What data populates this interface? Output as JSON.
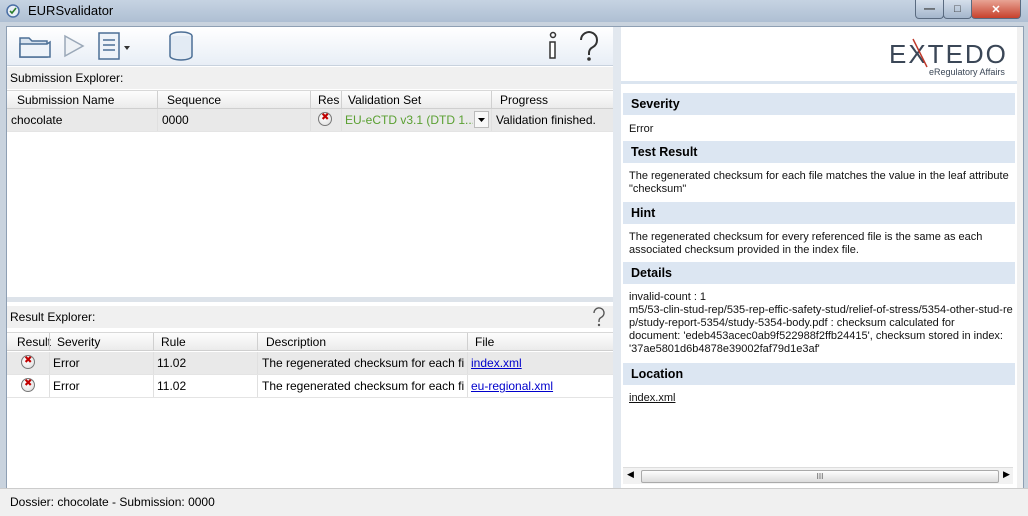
{
  "window": {
    "title": "EURSvalidator"
  },
  "logo": {
    "brand": "EXTEDO",
    "tagline": "eRegulatory Affairs"
  },
  "submission_explorer": {
    "title": "Submission Explorer:",
    "columns": [
      "Submission Name",
      "Sequence",
      "Resi",
      "Validation Set",
      "Progress"
    ],
    "rows": [
      {
        "name": "chocolate",
        "sequence": "0000",
        "result_icon": "error-icon",
        "validation_set": "EU-eCTD v3.1 (DTD 1...",
        "progress": "Validation finished."
      }
    ]
  },
  "result_explorer": {
    "title": "Result Explorer:",
    "columns": [
      "Result",
      "Severity",
      "Rule",
      "Description",
      "File"
    ],
    "rows": [
      {
        "result_icon": "error-icon",
        "severity": "Error",
        "rule": "11.02",
        "description": "The regenerated checksum for each fil...",
        "file": "index.xml"
      },
      {
        "result_icon": "error-icon",
        "severity": "Error",
        "rule": "11.02",
        "description": "The regenerated checksum for each fil...",
        "file": "eu-regional.xml"
      }
    ]
  },
  "details_panel": {
    "severity_label": "Severity",
    "severity_value": "Error",
    "test_result_label": "Test Result",
    "test_result_line1": "The regenerated checksum for each file matches the value in the leaf attribute",
    "test_result_line2": "\"checksum\"",
    "hint_label": "Hint",
    "hint_line1": "The regenerated checksum for every referenced file is the same as each",
    "hint_line2": "associated checksum provided in the index file.",
    "details_label": "Details",
    "details_line1": "invalid-count : 1",
    "details_line2": "m5/53-clin-stud-rep/535-rep-effic-safety-stud/relief-of-stress/5354-other-stud-re",
    "details_line3": "p/study-report-5354/study-5354-body.pdf : checksum calculated for",
    "details_line4": "document: 'edeb453acec0ab9f522988f2ffb24415', checksum stored in index:",
    "details_line5": "'37ae5801d6b4878e39002faf79d1e3af'",
    "location_label": "Location",
    "location_link": "index.xml",
    "scroll_thumb": "III"
  },
  "status_bar": {
    "text": "Dossier: chocolate - Submission: 0000"
  },
  "window_controls": {
    "close": "✕",
    "maximize": "□",
    "minimize": "—"
  },
  "help_glyph": "?",
  "info_glyph": "i"
}
